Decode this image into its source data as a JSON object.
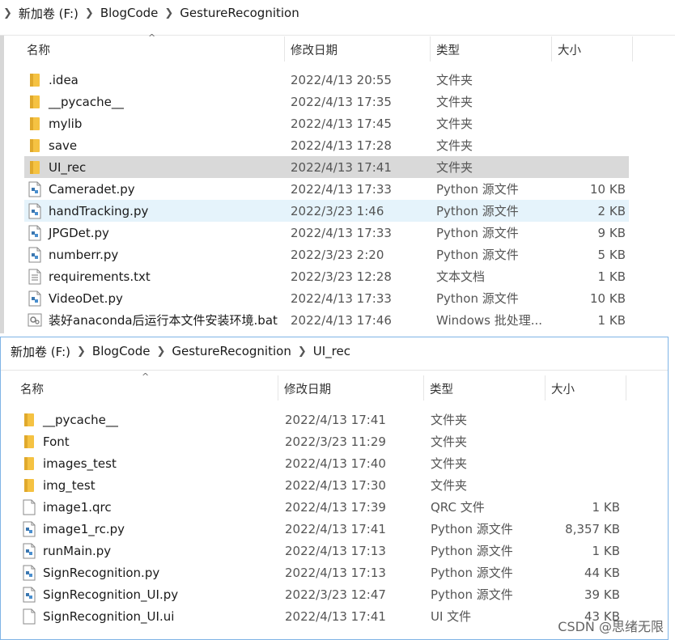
{
  "top": {
    "breadcrumb": [
      "新加卷 (F:)",
      "BlogCode",
      "GestureRecognition"
    ],
    "columns": {
      "name": "名称",
      "date": "修改日期",
      "type": "类型",
      "size": "大小"
    },
    "files": [
      {
        "name": ".idea",
        "date": "2022/4/13 20:55",
        "type": "文件夹",
        "size": "",
        "icon": "folder-icon"
      },
      {
        "name": "__pycache__",
        "date": "2022/4/13 17:35",
        "type": "文件夹",
        "size": "",
        "icon": "folder-icon"
      },
      {
        "name": "mylib",
        "date": "2022/4/13 17:45",
        "type": "文件夹",
        "size": "",
        "icon": "folder-icon"
      },
      {
        "name": "save",
        "date": "2022/4/13 17:28",
        "type": "文件夹",
        "size": "",
        "icon": "folder-icon"
      },
      {
        "name": "UI_rec",
        "date": "2022/4/13 17:41",
        "type": "文件夹",
        "size": "",
        "icon": "folder-icon"
      },
      {
        "name": "Cameradet.py",
        "date": "2022/4/13 17:33",
        "type": "Python 源文件",
        "size": "10 KB",
        "icon": "python-file-icon"
      },
      {
        "name": "handTracking.py",
        "date": "2022/3/23 1:46",
        "type": "Python 源文件",
        "size": "2 KB",
        "icon": "python-file-icon"
      },
      {
        "name": "JPGDet.py",
        "date": "2022/4/13 17:33",
        "type": "Python 源文件",
        "size": "9 KB",
        "icon": "python-file-icon"
      },
      {
        "name": "numberr.py",
        "date": "2022/3/23 2:20",
        "type": "Python 源文件",
        "size": "5 KB",
        "icon": "python-file-icon"
      },
      {
        "name": "requirements.txt",
        "date": "2022/3/23 12:28",
        "type": "文本文档",
        "size": "1 KB",
        "icon": "text-file-icon"
      },
      {
        "name": "VideoDet.py",
        "date": "2022/4/13 17:33",
        "type": "Python 源文件",
        "size": "10 KB",
        "icon": "python-file-icon"
      },
      {
        "name": "装好anaconda后运行本文件安装环境.bat",
        "date": "2022/4/13 17:46",
        "type": "Windows 批处理...",
        "size": "1 KB",
        "icon": "batch-file-icon"
      }
    ]
  },
  "bottom": {
    "breadcrumb": [
      "新加卷 (F:)",
      "BlogCode",
      "GestureRecognition",
      "UI_rec"
    ],
    "columns": {
      "name": "名称",
      "date": "修改日期",
      "type": "类型",
      "size": "大小"
    },
    "files": [
      {
        "name": "__pycache__",
        "date": "2022/4/13 17:41",
        "type": "文件夹",
        "size": "",
        "icon": "folder-icon"
      },
      {
        "name": "Font",
        "date": "2022/3/23 11:29",
        "type": "文件夹",
        "size": "",
        "icon": "folder-icon"
      },
      {
        "name": "images_test",
        "date": "2022/4/13 17:40",
        "type": "文件夹",
        "size": "",
        "icon": "folder-icon"
      },
      {
        "name": "img_test",
        "date": "2022/4/13 17:30",
        "type": "文件夹",
        "size": "",
        "icon": "folder-icon"
      },
      {
        "name": "image1.qrc",
        "date": "2022/4/13 17:39",
        "type": "QRC 文件",
        "size": "1 KB",
        "icon": "blank-file-icon"
      },
      {
        "name": "image1_rc.py",
        "date": "2022/4/13 17:41",
        "type": "Python 源文件",
        "size": "8,357 KB",
        "icon": "python-file-icon"
      },
      {
        "name": "runMain.py",
        "date": "2022/4/13 17:13",
        "type": "Python 源文件",
        "size": "1 KB",
        "icon": "python-file-icon"
      },
      {
        "name": "SignRecognition.py",
        "date": "2022/4/13 17:13",
        "type": "Python 源文件",
        "size": "44 KB",
        "icon": "python-file-icon"
      },
      {
        "name": "SignRecognition_UI.py",
        "date": "2022/3/23 12:47",
        "type": "Python 源文件",
        "size": "39 KB",
        "icon": "python-file-icon"
      },
      {
        "name": "SignRecognition_UI.ui",
        "date": "2022/4/13 17:41",
        "type": "UI 文件",
        "size": "43 KB",
        "icon": "blank-file-icon"
      }
    ]
  },
  "watermark": "CSDN @思绪无限",
  "colors": {
    "folder": "#f5c242",
    "selected_row": "#d9d9d9",
    "hover_row": "#e5f3fb",
    "window_border": "#7fb4e6"
  }
}
